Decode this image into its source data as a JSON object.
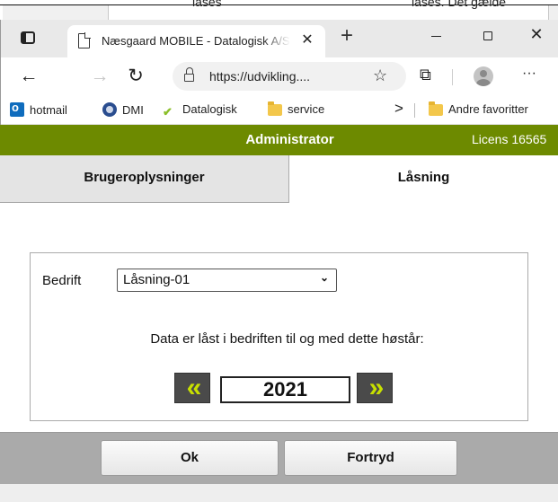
{
  "background_window": {
    "text_left": "låses",
    "text_right": "låses. Det gælde"
  },
  "browser": {
    "tab": {
      "title": "Næsgaard MOBILE - Datalogisk A/S",
      "close_glyph": "✕"
    },
    "new_tab_glyph": "+",
    "window_close_glyph": "✕",
    "toolbar": {
      "back_glyph": "←",
      "forward_glyph": "→",
      "refresh_glyph": "↻",
      "url": "https://udvikling....",
      "add_favorite_glyph": "☆",
      "extensions_glyph": "⧉",
      "more_glyph": "···"
    },
    "favorites": [
      {
        "label": "hotmail",
        "icon": "outlook-icon"
      },
      {
        "label": "DMI",
        "icon": "dmi-icon"
      },
      {
        "label": "Datalogisk",
        "icon": "datalogisk-icon"
      },
      {
        "label": "service",
        "icon": "folder-icon"
      }
    ],
    "favorites_overflow_glyph": ">",
    "other_favorites": "Andre favoritter"
  },
  "app": {
    "header_title": "Administrator",
    "license": "Licens 16565",
    "tabs": [
      {
        "label": "Brugeroplysninger",
        "active": false
      },
      {
        "label": "Låsning",
        "active": true
      }
    ],
    "form": {
      "company_label": "Bedrift",
      "company_value": "Låsning-01",
      "info_text": "Data er låst i bedriften til og med dette høstår:",
      "year": "2021",
      "prev_glyph": "«",
      "next_glyph": "»"
    },
    "buttons": {
      "ok": "Ok",
      "cancel": "Fortryd"
    }
  },
  "colors": {
    "header_bg": "#6d8a00",
    "arrow_green": "#c8e000",
    "footer_bg": "#aaaaaa"
  }
}
